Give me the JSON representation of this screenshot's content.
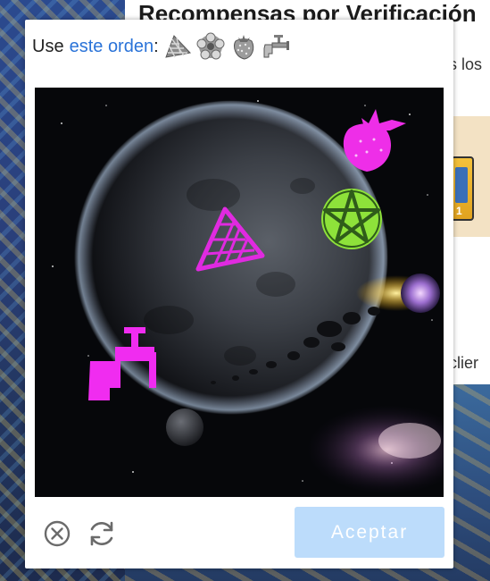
{
  "background": {
    "heading": "Recompensas por Verificación",
    "text_fragment_1": "s los",
    "text_fragment_2": "clier",
    "item_count": "1"
  },
  "captcha": {
    "prompt": {
      "prefix": "Use",
      "link": "este orden",
      "suffix": ":",
      "order_icons": [
        "pizza-slice-icon",
        "flower-pentacle-icon",
        "strawberry-icon",
        "faucet-icon"
      ]
    },
    "image_objects": [
      {
        "icon": "strawberry-icon",
        "color": "#ee2ee8"
      },
      {
        "icon": "pentacle-icon",
        "color": "#8ee23a"
      },
      {
        "icon": "pizza-slice-icon",
        "color": "#e02ae0"
      },
      {
        "icon": "faucet-icon",
        "color": "#f02cf0"
      }
    ],
    "controls": {
      "close_icon": "close-circle-icon",
      "refresh_icon": "refresh-icon",
      "accept_label": "Aceptar"
    },
    "colors": {
      "link": "#2a73d8",
      "accept_bg": "#bcdcfb",
      "accept_text": "#ffffff"
    }
  }
}
